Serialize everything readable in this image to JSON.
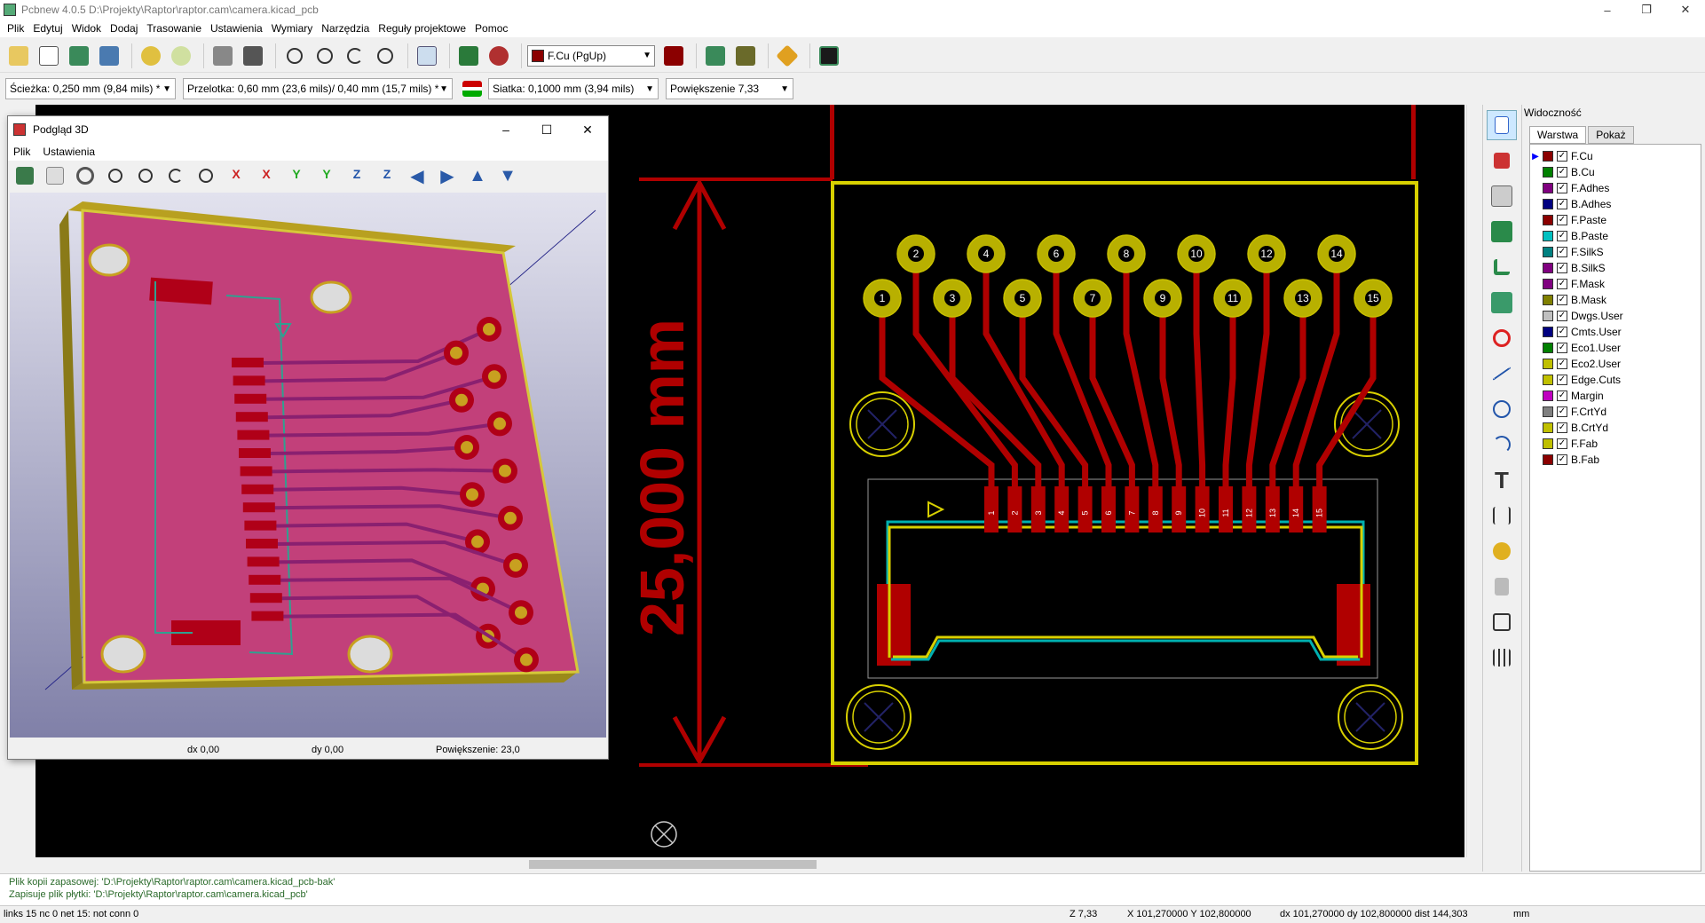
{
  "window": {
    "title": "Pcbnew 4.0.5 D:\\Projekty\\Raptor\\raptor.cam\\camera.kicad_pcb",
    "controls": [
      "–",
      "❐",
      "✕"
    ]
  },
  "menu": [
    "Plik",
    "Edytuj",
    "Widok",
    "Dodaj",
    "Trasowanie",
    "Ustawienia",
    "Wymiary",
    "Narzędzia",
    "Reguły projektowe",
    "Pomoc"
  ],
  "toolbar": {
    "active_layer": "F.Cu (PgUp)",
    "active_layer_color": "#8b0000"
  },
  "toolbar2": {
    "track": "Ścieżka: 0,250 mm (9,84 mils) *",
    "via": "Przelotka: 0,60 mm (23,6 mils)/ 0,40 mm (15,7 mils) *",
    "grid": "Siatka: 0,1000 mm (3,94 mils)",
    "zoom": "Powiększenie 7,33"
  },
  "viewer3d": {
    "title": "Podgląd 3D",
    "menu": [
      "Plik",
      "Ustawienia"
    ],
    "status": {
      "dx": "dx 0,00",
      "dy": "dy 0,00",
      "zoom": "Powiększenie: 23,0"
    },
    "colors": {
      "board": "#c2407a",
      "edge": "#d6c83a",
      "pad": "#c8a020"
    }
  },
  "pcb": {
    "dimension_label": "25,000 mm",
    "top_pads": [
      "2",
      "4",
      "6",
      "8",
      "10",
      "12",
      "14"
    ],
    "bottom_pads": [
      "1",
      "3",
      "5",
      "7",
      "9",
      "11",
      "13",
      "15"
    ],
    "smd_pads": [
      "1",
      "2",
      "3",
      "4",
      "5",
      "6",
      "7",
      "8",
      "9",
      "10",
      "11",
      "12",
      "13",
      "14",
      "15"
    ],
    "colors": {
      "copper": "#b00000",
      "edge": "#d8d000",
      "silk": "#00b0b0",
      "pad_ring": "#b8b000"
    }
  },
  "visibility": {
    "header": "Widoczność",
    "tabs": [
      "Warstwa",
      "Pokaż"
    ],
    "layers": [
      {
        "name": "F.Cu",
        "color": "#8b0000"
      },
      {
        "name": "B.Cu",
        "color": "#008000"
      },
      {
        "name": "F.Adhes",
        "color": "#800080"
      },
      {
        "name": "B.Adhes",
        "color": "#000080"
      },
      {
        "name": "F.Paste",
        "color": "#8b0000"
      },
      {
        "name": "B.Paste",
        "color": "#00c0c0"
      },
      {
        "name": "F.SilkS",
        "color": "#008080"
      },
      {
        "name": "B.SilkS",
        "color": "#800080"
      },
      {
        "name": "F.Mask",
        "color": "#800080"
      },
      {
        "name": "B.Mask",
        "color": "#808000"
      },
      {
        "name": "Dwgs.User",
        "color": "#c0c0c0"
      },
      {
        "name": "Cmts.User",
        "color": "#000080"
      },
      {
        "name": "Eco1.User",
        "color": "#008000"
      },
      {
        "name": "Eco2.User",
        "color": "#c0c000"
      },
      {
        "name": "Edge.Cuts",
        "color": "#c0c000"
      },
      {
        "name": "Margin",
        "color": "#c000c0"
      },
      {
        "name": "F.CrtYd",
        "color": "#808080"
      },
      {
        "name": "B.CrtYd",
        "color": "#c0c000"
      },
      {
        "name": "F.Fab",
        "color": "#c0c000"
      },
      {
        "name": "B.Fab",
        "color": "#8b0000"
      }
    ]
  },
  "messages": [
    "Plik kopii zapasowej: 'D:\\Projekty\\Raptor\\raptor.cam\\camera.kicad_pcb-bak'",
    "Zapisuje plik płytki: 'D:\\Projekty\\Raptor\\raptor.cam\\camera.kicad_pcb'"
  ],
  "status": {
    "links": "links 15 nc 0  net 15: not conn 0",
    "z": "Z 7,33",
    "xy": "X 101,270000  Y 102,800000",
    "dxy": "dx 101,270000  dy 102,800000  dist 144,303",
    "units": "mm"
  }
}
